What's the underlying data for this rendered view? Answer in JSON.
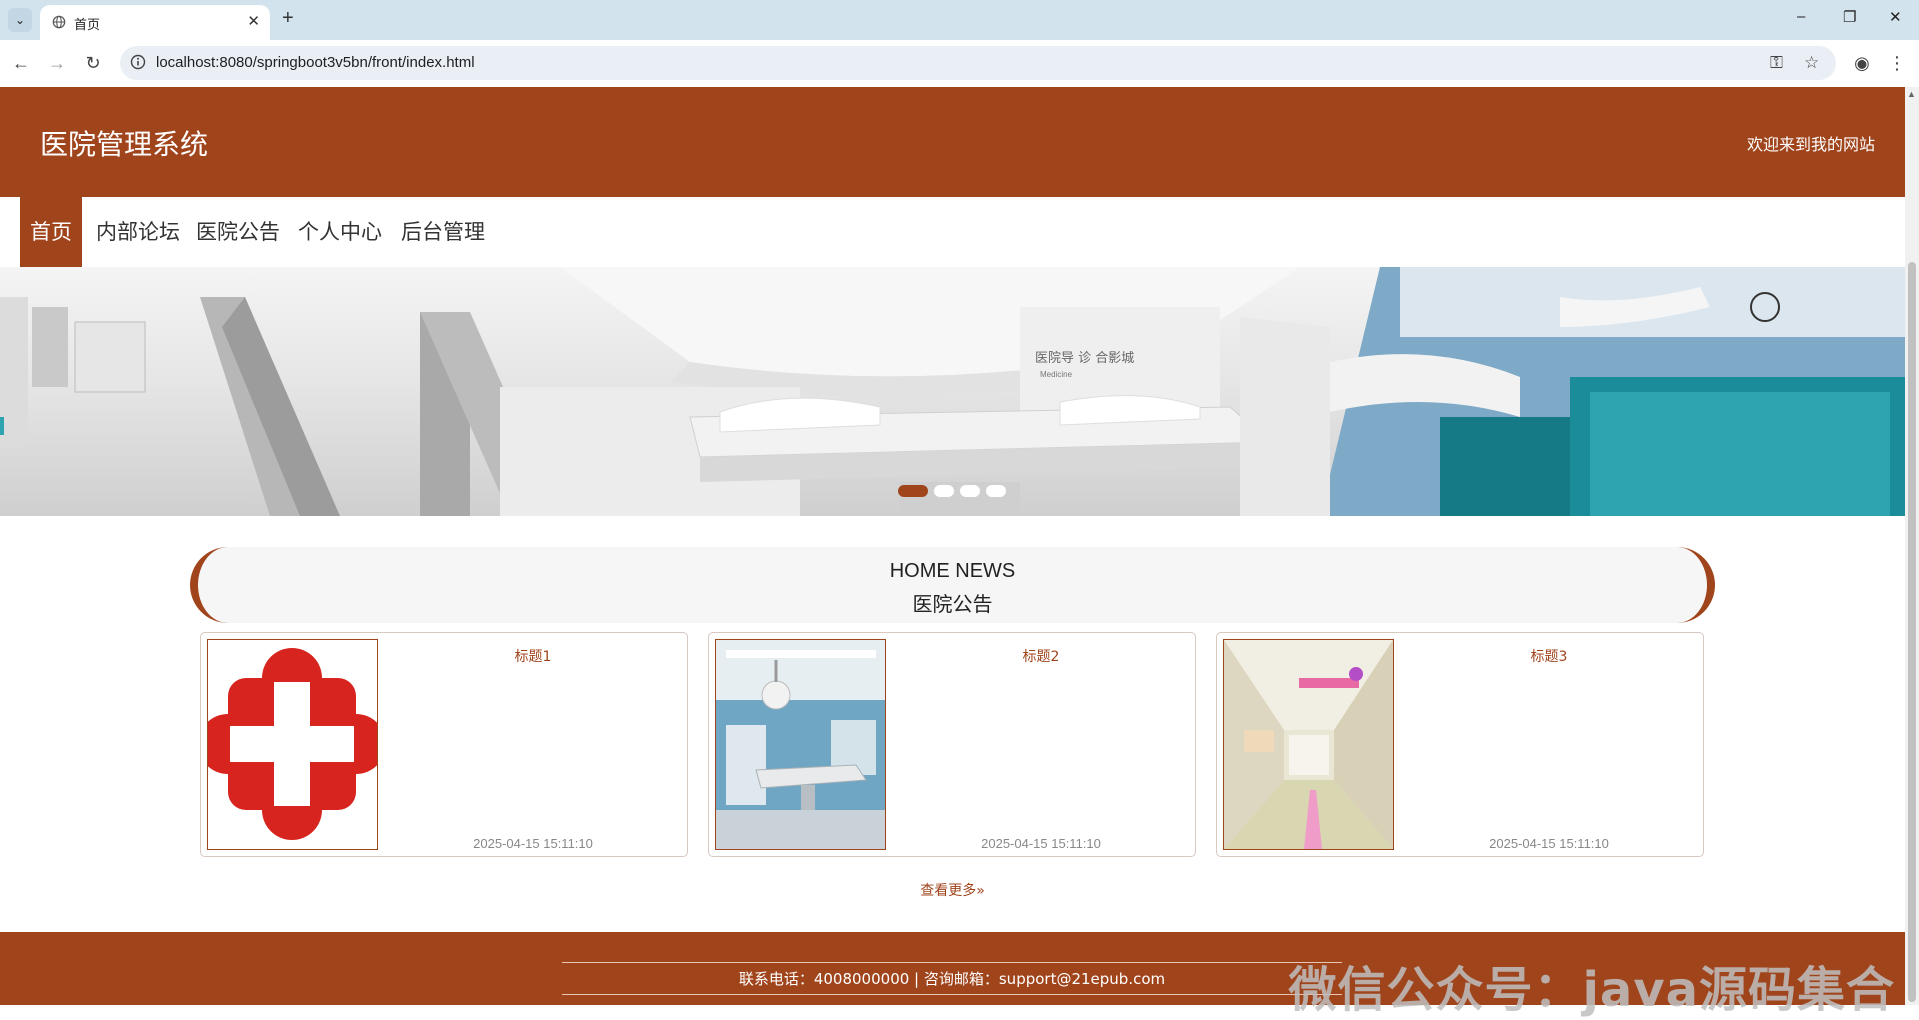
{
  "browser": {
    "tab_title": "首页",
    "url": "localhost:8080/springboot3v5bn/front/index.html"
  },
  "header": {
    "site_title": "医院管理系统",
    "welcome": "欢迎来到我的网站"
  },
  "nav": {
    "items": [
      {
        "label": "首页",
        "active": true
      },
      {
        "label": "内部论坛",
        "active": false
      },
      {
        "label": "医院公告",
        "active": false
      },
      {
        "label": "个人中心",
        "active": false
      },
      {
        "label": "后台管理",
        "active": false
      }
    ]
  },
  "banner": {
    "slides": 4,
    "active_slide": 1,
    "sign_text": [
      "医院导 诊 合影城",
      "Medicine"
    ]
  },
  "news": {
    "heading_en": "HOME NEWS",
    "heading_cn": "医院公告",
    "items": [
      {
        "title": "标题1",
        "date": "2025-04-15 15:11:10",
        "image": "red-cross-logo"
      },
      {
        "title": "标题2",
        "date": "2025-04-15 15:11:10",
        "image": "operating-room-photo"
      },
      {
        "title": "标题3",
        "date": "2025-04-15 15:11:10",
        "image": "hospital-corridor-photo"
      }
    ],
    "more_label": "查看更多»"
  },
  "footer": {
    "contact": "联系电话：4008000000 | 咨询邮箱：support@21epub.com",
    "watermark": "微信公众号：java源码集合"
  },
  "colors": {
    "brand": "#a0441c",
    "chrome_tab_bar": "#d3e3ee"
  }
}
